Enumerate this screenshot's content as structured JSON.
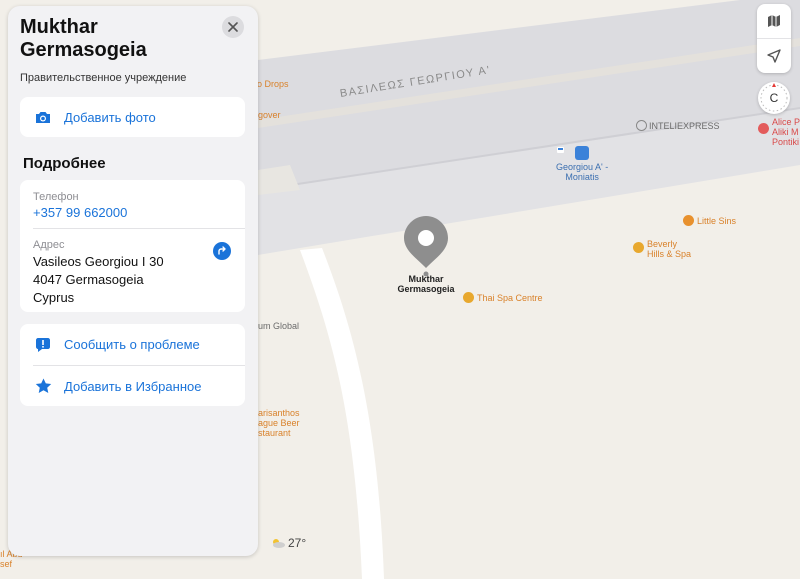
{
  "place": {
    "name": "Mukthar Germasogeia",
    "category": "Правительственное учреждение",
    "add_photo_label": "Добавить фото"
  },
  "details": {
    "heading": "Подробнее",
    "phone_label": "Телефон",
    "phone_value": "+357 99 662000",
    "address_label": "Адрес",
    "address_line1": "Vasileos Georgiou I 30",
    "address_line2": "4047 Germasogeia",
    "address_line3": "Cyprus"
  },
  "actions": {
    "report_label": "Сообщить о проблеме",
    "favorite_label": "Добавить в Избранное"
  },
  "map": {
    "road_label": "ΒΑΣΙΛΕΩΣ ΓΕΩΡΓΙΟΥ Α'",
    "pin_label_line1": "Mukthar",
    "pin_label_line2": "Germasogeia",
    "bus_stop_line1": "Georgiou A' -",
    "bus_stop_line2": "Moniatis",
    "inteliexpress": "INTELIEXPRESS",
    "little_sins": "Little Sins",
    "beverly_line1": "Beverly",
    "beverly_line2": "Hills & Spa",
    "thai_spa": "Thai Spa Centre",
    "alice_line1": "Alice P",
    "alice_line2": "Aliki M",
    "alice_line3": "Pontiki",
    "drops": "o Drops",
    "gover": "gover",
    "um_global": "um Global",
    "charisanthos_line1": "arisanthos",
    "charisanthos_line2": "ague Beer",
    "charisanthos_line3": "staurant",
    "left_edge_1": "ıl Abd",
    "left_edge_2": "sef",
    "temperature": "27°",
    "compass_letter": "С"
  },
  "colors": {
    "accent": "#1a73d9",
    "poi_orange": "#d9822b",
    "pin_gray": "#8e8e8e"
  },
  "icons": {
    "close": "close-icon",
    "camera": "camera-icon",
    "directions": "directions-icon",
    "report": "exclamation-bubble-icon",
    "favorite": "star-icon",
    "map_mode": "map-icon",
    "location": "location-arrow-icon",
    "weather": "partly-cloudy-icon"
  }
}
